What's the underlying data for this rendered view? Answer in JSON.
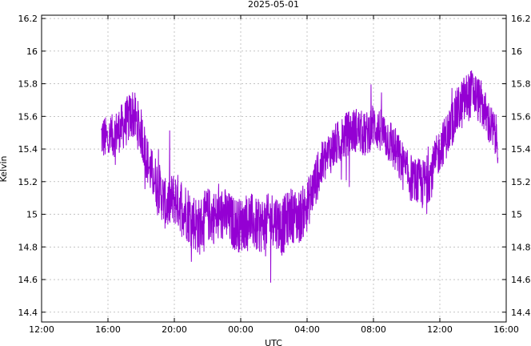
{
  "chart_data": {
    "type": "line",
    "title": "2025-05-01",
    "xlabel": "UTC",
    "ylabel": "Kelvin",
    "x_unit": "hours since 12:00",
    "x_range": [
      0,
      28
    ],
    "x_ticks": [
      0,
      4,
      8,
      12,
      16,
      20,
      24,
      28
    ],
    "x_tick_labels": [
      "12:00",
      "16:00",
      "20:00",
      "00:00",
      "04:00",
      "08:00",
      "12:00",
      "16:00"
    ],
    "ylim": [
      14.34,
      16.22
    ],
    "y_ticks": [
      14.4,
      14.6,
      14.8,
      15.0,
      15.2,
      15.4,
      15.6,
      15.8,
      16.0,
      16.2
    ],
    "y_tick_labels": [
      "14.4",
      "14.6",
      "14.8",
      "15",
      "15.2",
      "15.4",
      "15.6",
      "15.8",
      "16",
      "16.2"
    ],
    "right_axis_mirror": true,
    "grid": true,
    "legend": "none",
    "series_color": "#9400d3",
    "series": [
      {
        "x": [
          3.6,
          4.0,
          4.5,
          5.0,
          5.5,
          6.0,
          6.5,
          7.0,
          7.5,
          8.0,
          8.5,
          9.0,
          9.5,
          10.0,
          10.5,
          11.0,
          11.5,
          12.0,
          12.5,
          13.0,
          13.5,
          14.0,
          14.5,
          15.0,
          15.5,
          16.0,
          16.5,
          17.0,
          17.5,
          18.0,
          18.5,
          19.0,
          19.5,
          20.0,
          20.5,
          21.0,
          21.5,
          22.0,
          22.5,
          23.0,
          23.5,
          24.0,
          24.5,
          25.0,
          25.5,
          26.0,
          26.5,
          27.0,
          27.5
        ],
        "y": [
          15.48,
          15.45,
          15.5,
          15.55,
          15.62,
          15.5,
          15.28,
          15.18,
          15.05,
          15.1,
          15.05,
          14.98,
          14.92,
          15.0,
          14.98,
          15.0,
          14.95,
          14.93,
          14.98,
          14.92,
          14.95,
          14.98,
          14.92,
          15.0,
          14.98,
          15.05,
          15.2,
          15.32,
          15.4,
          15.45,
          15.5,
          15.52,
          15.48,
          15.55,
          15.5,
          15.45,
          15.35,
          15.25,
          15.2,
          15.18,
          15.25,
          15.4,
          15.5,
          15.62,
          15.7,
          15.75,
          15.68,
          15.55,
          15.45
        ],
        "noise": [
          0.14,
          0.14,
          0.14,
          0.15,
          0.16,
          0.15,
          0.15,
          0.16,
          0.16,
          0.17,
          0.18,
          0.18,
          0.18,
          0.17,
          0.17,
          0.17,
          0.17,
          0.17,
          0.17,
          0.17,
          0.17,
          0.17,
          0.18,
          0.17,
          0.17,
          0.16,
          0.15,
          0.15,
          0.14,
          0.14,
          0.14,
          0.14,
          0.14,
          0.14,
          0.14,
          0.15,
          0.15,
          0.15,
          0.15,
          0.16,
          0.15,
          0.14,
          0.14,
          0.15,
          0.16,
          0.15,
          0.14,
          0.14,
          0.14
        ]
      }
    ]
  }
}
